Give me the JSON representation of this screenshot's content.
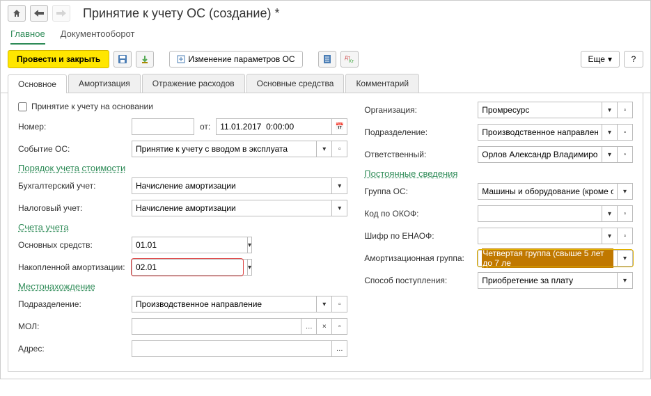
{
  "header": {
    "title": "Принятие к учету ОС (создание) *"
  },
  "nav": {
    "main": "Главное",
    "docflow": "Документооборот"
  },
  "toolbar": {
    "postClose": "Провести и закрыть",
    "changeParams": "Изменение параметров ОС",
    "more": "Еще"
  },
  "tabs": {
    "main": "Основное",
    "amort": "Амортизация",
    "expenses": "Отражение расходов",
    "assets": "Основные средства",
    "comment": "Комментарий"
  },
  "left": {
    "checkbox": "Принятие к учету на основании",
    "numberLabel": "Номер:",
    "numberValue": "",
    "fromLabel": "от:",
    "dateValue": "11.01.2017  0:00:00",
    "eventLabel": "Событие ОС:",
    "eventValue": "Принятие к учету с вводом в эксплуата",
    "sectionCost": "Порядок учета стоимости",
    "accLabel": "Бухгалтерский учет:",
    "accValue": "Начисление амортизации",
    "taxLabel": "Налоговый учет:",
    "taxValue": "Начисление амортизации",
    "sectionAccounts": "Счета учета",
    "fixedLabel": "Основных средств:",
    "fixedValue": "01.01",
    "amortLabel": "Накопленной амортизации:",
    "amortValue": "02.01",
    "sectionLoc": "Местонахождение",
    "deptLabel": "Подразделение:",
    "deptValue": "Производственное направление",
    "molLabel": "МОЛ:",
    "molValue": "",
    "addrLabel": "Адрес:",
    "addrValue": ""
  },
  "right": {
    "orgLabel": "Организация:",
    "orgValue": "Промресурс",
    "deptLabel": "Подразделение:",
    "deptValue": "Производственное направление",
    "respLabel": "Ответственный:",
    "respValue": "Орлов Александр Владимирович",
    "sectionConst": "Постоянные сведения",
    "groupLabel": "Группа ОС:",
    "groupValue": "Машины и оборудование (кроме офисн",
    "okofLabel": "Код по ОКОФ:",
    "okofValue": "",
    "enaofLabel": "Шифр по ЕНАОФ:",
    "enaofValue": "",
    "amortGroupLabel": "Амортизационная группа:",
    "amortGroupValue": "Четвертая группа (свыше 5 лет до 7 ле",
    "methodLabel": "Способ поступления:",
    "methodValue": "Приобретение за плату"
  }
}
